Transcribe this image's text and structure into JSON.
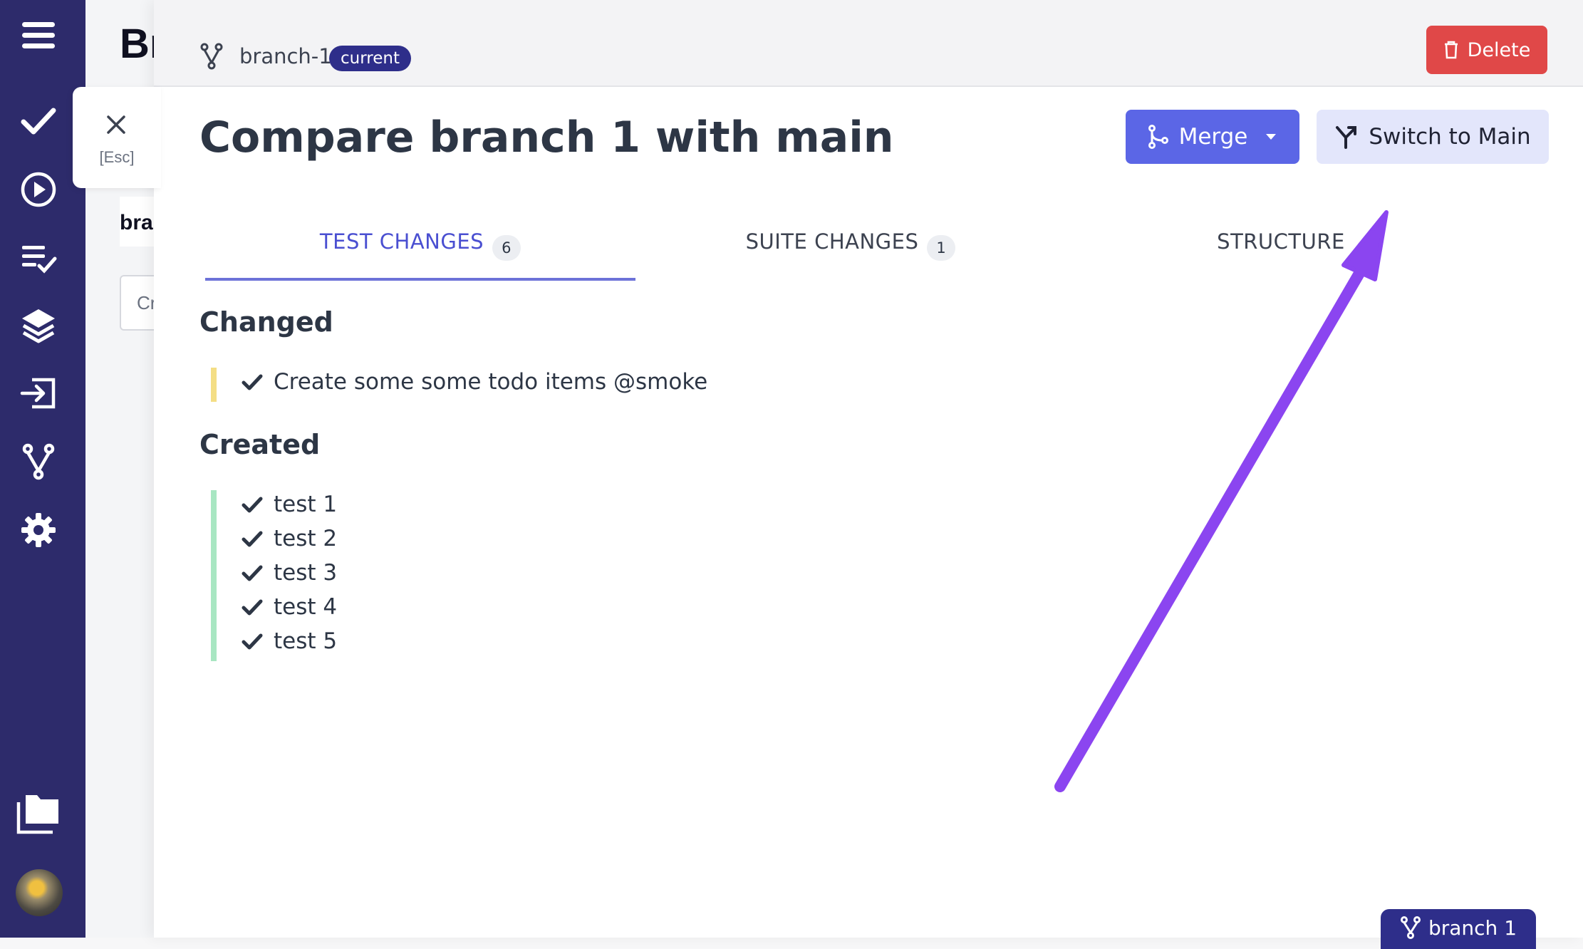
{
  "sidebar": {
    "items": [
      {
        "icon": "menu-icon"
      },
      {
        "icon": "check-icon"
      },
      {
        "icon": "play-circle-icon"
      },
      {
        "icon": "checklist-icon"
      },
      {
        "icon": "layers-icon"
      },
      {
        "icon": "import-icon"
      },
      {
        "icon": "branch-icon"
      },
      {
        "icon": "gear-icon"
      },
      {
        "icon": "folders-icon"
      },
      {
        "icon": "avatar"
      }
    ]
  },
  "background_page": {
    "title_fragment": "Br",
    "card_fragment": "bra",
    "input_fragment": "Cr"
  },
  "close": {
    "label": "[Esc]"
  },
  "header": {
    "branch_name": "branch-1",
    "badge": "current",
    "delete_label": "Delete"
  },
  "main": {
    "title": "Compare branch 1 with main",
    "merge_label": "Merge",
    "switch_label": "Switch to Main",
    "tabs": [
      {
        "label": "TEST CHANGES",
        "count": "6",
        "active": true
      },
      {
        "label": "SUITE CHANGES",
        "count": "1",
        "active": false
      },
      {
        "label": "STRUCTURE",
        "count": "",
        "active": false
      }
    ],
    "sections": [
      {
        "title": "Changed",
        "bar_color": "#f4de85",
        "items": [
          "Create some some todo items @smoke"
        ]
      },
      {
        "title": "Created",
        "bar_color": "#a8e6c2",
        "items": [
          "test 1",
          "test 2",
          "test 3",
          "test 4",
          "test 5"
        ]
      }
    ]
  },
  "footer": {
    "branch_pill": "branch 1"
  },
  "colors": {
    "sidebar": "#2d2b6b",
    "primary": "#5b66e6",
    "delete": "#e04848",
    "annotation_arrow": "#8b45f0"
  }
}
